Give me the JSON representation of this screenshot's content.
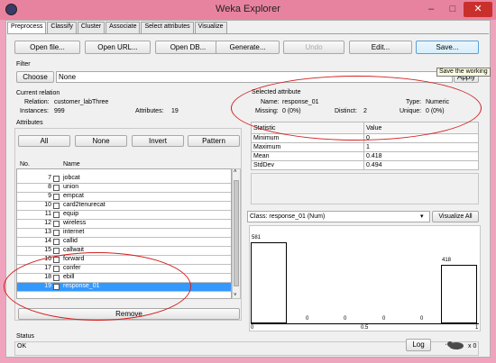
{
  "window": {
    "title": "Weka Explorer",
    "minimize": "–",
    "maximize": "□",
    "close": "✕"
  },
  "tabs": [
    "Preprocess",
    "Classify",
    "Cluster",
    "Associate",
    "Select attributes",
    "Visualize"
  ],
  "toolbar": {
    "open_file": "Open file...",
    "open_url": "Open URL...",
    "open_db": "Open DB...",
    "generate": "Generate...",
    "undo": "Undo",
    "edit": "Edit...",
    "save": "Save..."
  },
  "tooltip": "Save the working",
  "filter": {
    "section": "Filter",
    "choose": "Choose",
    "value": "None",
    "apply": "Apply"
  },
  "current_relation": {
    "section": "Current relation",
    "relation_label": "Relation:",
    "relation": "customer_labThree",
    "instances_label": "Instances:",
    "instances": "999",
    "attributes_label": "Attributes:",
    "attributes": "19"
  },
  "attributes": {
    "section": "Attributes",
    "buttons": {
      "all": "All",
      "none": "None",
      "invert": "Invert",
      "pattern": "Pattern"
    },
    "col_no": "No.",
    "col_name": "Name",
    "rows": [
      {
        "no": "7",
        "name": "jobcat"
      },
      {
        "no": "8",
        "name": "union"
      },
      {
        "no": "9",
        "name": "empcat"
      },
      {
        "no": "10",
        "name": "card2tenurecat"
      },
      {
        "no": "11",
        "name": "equip"
      },
      {
        "no": "12",
        "name": "wireless"
      },
      {
        "no": "13",
        "name": "internet"
      },
      {
        "no": "14",
        "name": "callid"
      },
      {
        "no": "15",
        "name": "callwait"
      },
      {
        "no": "16",
        "name": "forward"
      },
      {
        "no": "17",
        "name": "confer"
      },
      {
        "no": "18",
        "name": "ebill"
      },
      {
        "no": "19",
        "name": "response_01",
        "selected": true
      }
    ],
    "remove": "Remove"
  },
  "selected_attribute": {
    "section": "Selected attribute",
    "name_label": "Name:",
    "name": "response_01",
    "type_label": "Type:",
    "type": "Numeric",
    "missing_label": "Missing:",
    "missing": "0 (0%)",
    "distinct_label": "Distinct:",
    "distinct": "2",
    "unique_label": "Unique:",
    "unique": "0 (0%)",
    "stats_header": [
      "Statistic",
      "Value"
    ],
    "stats": [
      [
        "Minimum",
        "0"
      ],
      [
        "Maximum",
        "1"
      ],
      [
        "Mean",
        "0.418"
      ],
      [
        "StdDev",
        "0.494"
      ]
    ]
  },
  "class_select": {
    "value": "Class: response_01 (Num)",
    "visualize_all": "Visualize All"
  },
  "histogram": {
    "bars": [
      {
        "label": "581",
        "value": 581
      },
      {
        "label": "0",
        "value": 0
      },
      {
        "label": "0",
        "value": 0
      },
      {
        "label": "0",
        "value": 0
      },
      {
        "label": "0",
        "value": 0
      },
      {
        "label": "418",
        "value": 418
      }
    ],
    "axis": [
      "0",
      "0.5",
      "1"
    ]
  },
  "status": {
    "section": "Status",
    "text": "OK",
    "log": "Log",
    "count": "x 0"
  },
  "colors": {
    "title_bar": "#e8839f",
    "selection": "#3399ff",
    "annotation": "#d42020"
  },
  "icons": [
    "weka-app-icon",
    "weka-bird-icon",
    "dropdown-arrow-icon",
    "scroll-up-icon",
    "scroll-down-icon"
  ]
}
